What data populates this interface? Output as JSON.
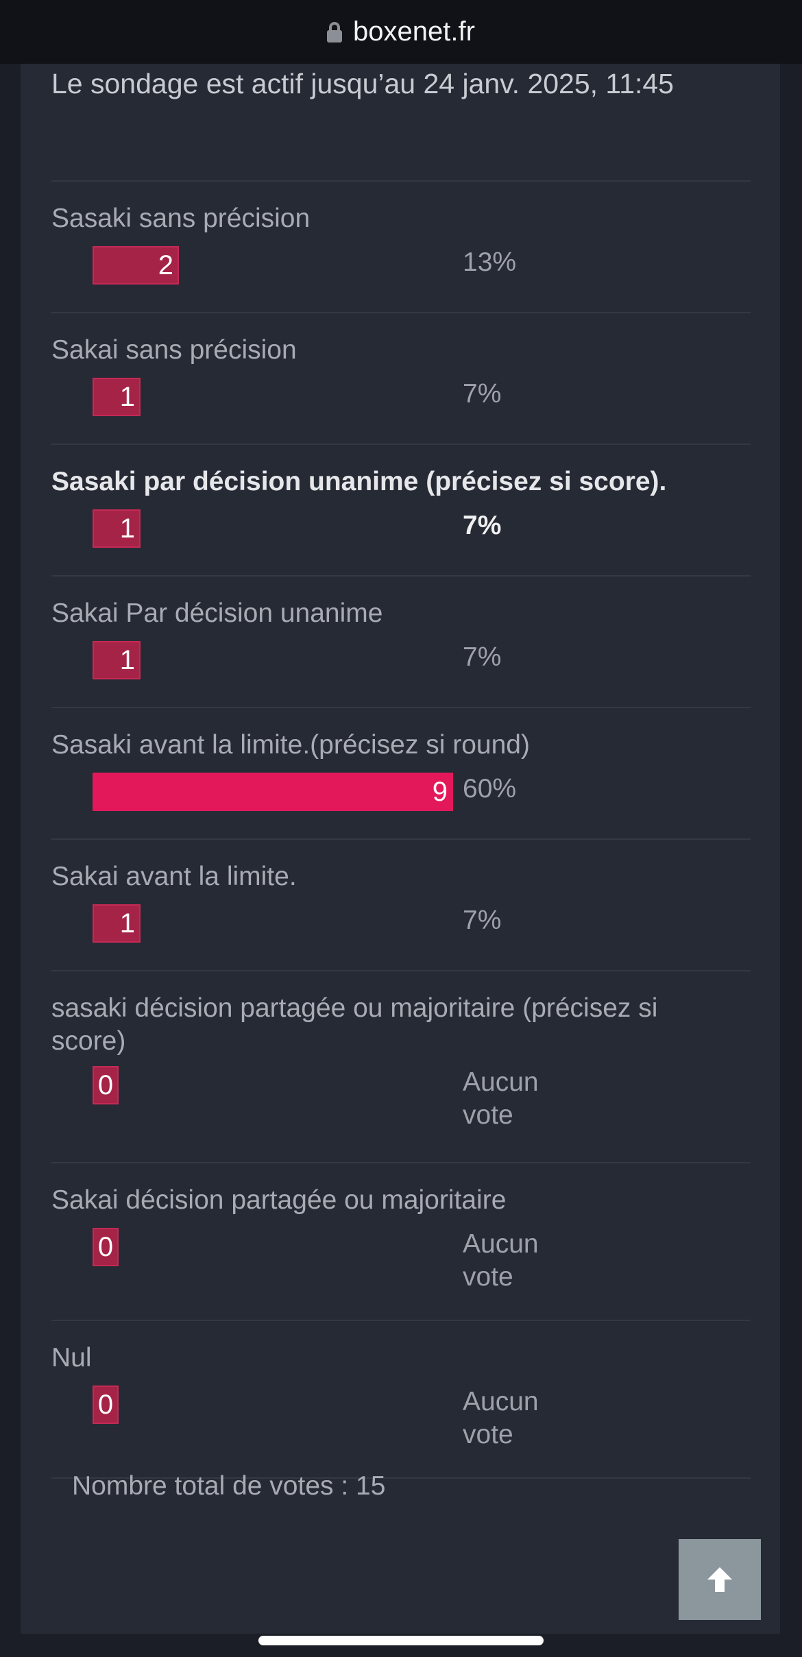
{
  "browser": {
    "domain": "boxenet.fr"
  },
  "poll": {
    "status": "Le sondage est actif jusqu’au 24 janv. 2025, 11:45",
    "options": [
      {
        "label": "Sasaki sans précision",
        "votes": "2",
        "percent": "13%",
        "share": 0.13
      },
      {
        "label": "Sakai sans précision",
        "votes": "1",
        "percent": "7%",
        "share": 0.07
      },
      {
        "label": "Sasaki par décision unanime (précisez si score).",
        "votes": "1",
        "percent": "7%",
        "share": 0.07
      },
      {
        "label": "Sakai Par décision unanime",
        "votes": "1",
        "percent": "7%",
        "share": 0.07
      },
      {
        "label": "Sasaki avant la limite.(précisez si round)",
        "votes": "9",
        "percent": "60%",
        "share": 0.6
      },
      {
        "label": "Sakai avant la limite.",
        "votes": "1",
        "percent": "7%",
        "share": 0.07
      },
      {
        "label": "sasaki décision partagée ou majoritaire (précisez si score)",
        "votes": "0",
        "percent": "Aucun vote",
        "share": 0
      },
      {
        "label": "Sakai décision partagée ou majoritaire",
        "votes": "0",
        "percent": "Aucun vote",
        "share": 0
      },
      {
        "label": "Nul",
        "votes": "0",
        "percent": "Aucun vote",
        "share": 0
      }
    ],
    "total": "Nombre total de votes : 15"
  },
  "colors": {
    "bar": "#a52347",
    "bar_leading": "#e3185a",
    "panel": "#262a35",
    "page": "#1b1e26"
  },
  "icons": {
    "lock": "lock-icon",
    "scroll_top": "arrow-up-icon"
  }
}
